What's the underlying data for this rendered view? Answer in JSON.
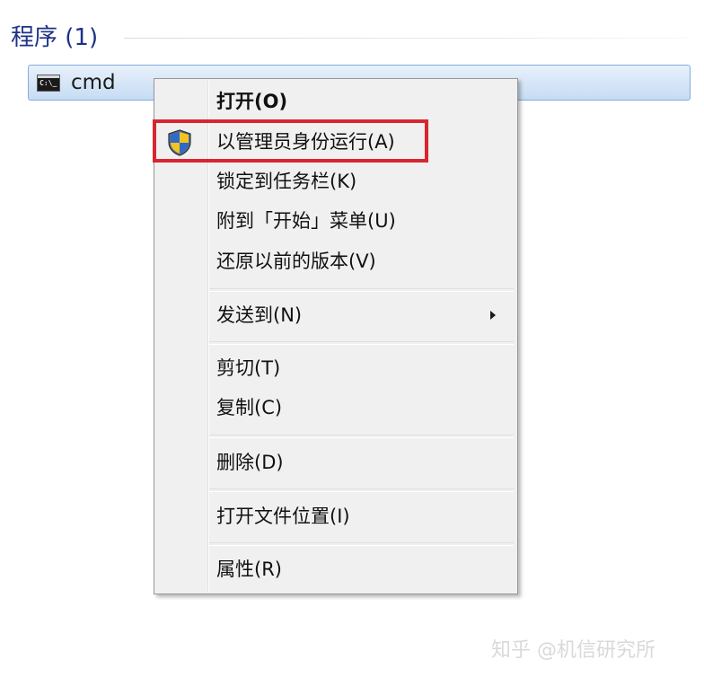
{
  "section": {
    "title": "程序 (1)"
  },
  "result": {
    "label": "cmd",
    "icon": "command-prompt-icon",
    "icon_text": "C:\\_"
  },
  "context_menu": {
    "items": [
      {
        "label": "打开(O)",
        "bold": true
      },
      {
        "label": "以管理员身份运行(A)",
        "icon": "uac-shield-icon"
      },
      {
        "label": "锁定到任务栏(K)"
      },
      {
        "label": "附到「开始」菜单(U)"
      },
      {
        "label": "还原以前的版本(V)"
      },
      {
        "label": "发送到(N)",
        "submenu": true
      },
      {
        "label": "剪切(T)"
      },
      {
        "label": "复制(C)"
      },
      {
        "label": "删除(D)"
      },
      {
        "label": "打开文件位置(I)"
      },
      {
        "label": "属性(R)"
      }
    ]
  },
  "annotation": {
    "highlight_color": "#d7262f",
    "highlighted_item": "以管理员身份运行(A)"
  },
  "watermark": {
    "text": "知乎 @机信研究所"
  },
  "colors": {
    "section_title": "#1e3287",
    "selection_border": "#84acdd",
    "menu_background": "#f0f0f0"
  }
}
